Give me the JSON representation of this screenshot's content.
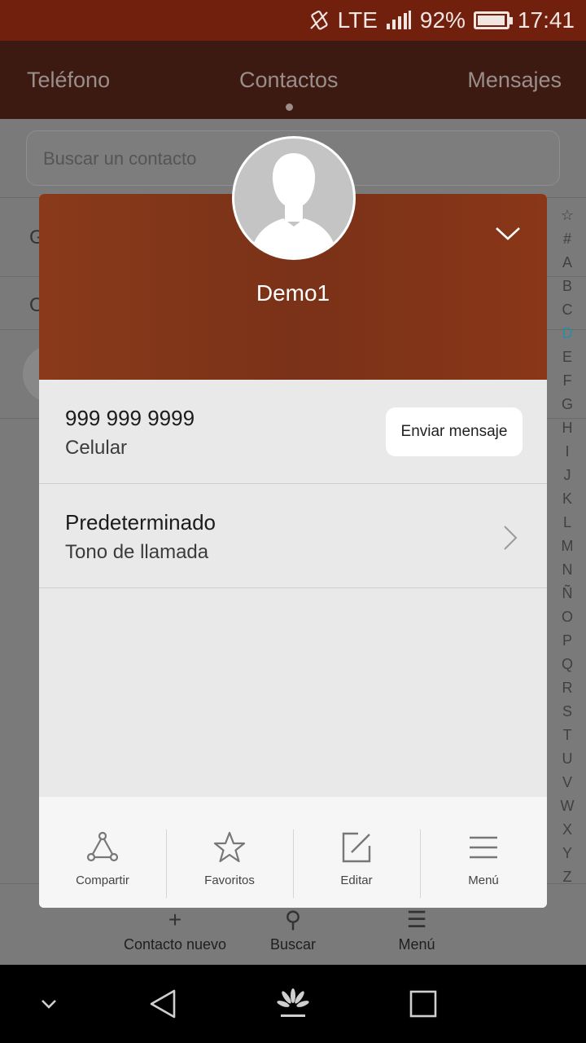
{
  "status_bar": {
    "network": "LTE",
    "battery": "92%",
    "battery_level": 0.92,
    "time": "17:41"
  },
  "tabs": [
    {
      "label": "Teléfono"
    },
    {
      "label": "Contactos",
      "selected": true
    },
    {
      "label": "Mensajes"
    }
  ],
  "background": {
    "search_placeholder": "Buscar un contacto",
    "row_letters": [
      "G",
      "O"
    ],
    "actions": [
      {
        "label": "Contacto nuevo",
        "icon": "plus-icon"
      },
      {
        "label": "Buscar",
        "icon": "search-icon"
      },
      {
        "label": "Menú",
        "icon": "menu-icon"
      }
    ]
  },
  "alpha_index": [
    "☆",
    "#",
    "A",
    "B",
    "C",
    "D",
    "E",
    "F",
    "G",
    "H",
    "I",
    "J",
    "K",
    "L",
    "M",
    "N",
    "Ñ",
    "O",
    "P",
    "Q",
    "R",
    "S",
    "T",
    "U",
    "V",
    "W",
    "X",
    "Y",
    "Z"
  ],
  "alpha_active": "D",
  "contact": {
    "name": "Demo1",
    "phone": "999 999 9999",
    "phone_type": "Celular",
    "send_message": "Enviar mensaje",
    "ringtone": "Predeterminado",
    "ringtone_label": "Tono de llamada"
  },
  "card_actions": [
    {
      "label": "Compartir",
      "icon": "share-icon"
    },
    {
      "label": "Favoritos",
      "icon": "star-icon"
    },
    {
      "label": "Editar",
      "icon": "edit-icon"
    },
    {
      "label": "Menú",
      "icon": "menu-icon"
    }
  ],
  "colors": {
    "header": "#7f361a",
    "status_bar": "#72200e",
    "tabs_bg": "#3c1a12",
    "alpha_active": "#2a8ea0"
  }
}
